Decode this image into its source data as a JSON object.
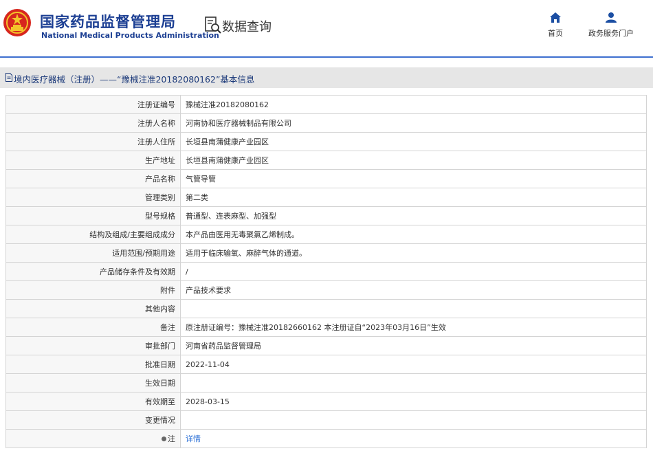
{
  "header": {
    "logo_cn": "国家药品监督管理局",
    "logo_en": "National Medical Products Administration",
    "query_title": "数据查询",
    "nav": [
      {
        "label": "首页",
        "icon": "home-icon"
      },
      {
        "label": "政务服务门户",
        "icon": "user-icon"
      }
    ]
  },
  "breadcrumb": {
    "text": "境内医疗器械（注册）——“豫械注准20182080162”基本信息",
    "icon": "document-icon"
  },
  "rows": [
    {
      "label": "注册证编号",
      "value": "豫械注准20182080162"
    },
    {
      "label": "注册人名称",
      "value": "河南协和医疗器械制品有限公司"
    },
    {
      "label": "注册人住所",
      "value": "长垣县南蒲健康产业园区"
    },
    {
      "label": "生产地址",
      "value": "长垣县南蒲健康产业园区"
    },
    {
      "label": "产品名称",
      "value": "气管导管"
    },
    {
      "label": "管理类别",
      "value": "第二类"
    },
    {
      "label": "型号规格",
      "value": "普通型、连表麻型、加强型"
    },
    {
      "label": "结构及组成/主要组成成分",
      "value": "本产品由医用无毒聚氯乙烯制成。"
    },
    {
      "label": "适用范围/预期用途",
      "value": "适用于临床输氧、麻醉气体的通道。"
    },
    {
      "label": "产品储存条件及有效期",
      "value": "/"
    },
    {
      "label": "附件",
      "value": "产品技术要求"
    },
    {
      "label": "其他内容",
      "value": ""
    },
    {
      "label": "备注",
      "value": "原注册证编号：豫械注准20182660162 本注册证自“2023年03月16日”生效"
    },
    {
      "label": "审批部门",
      "value": "河南省药品监督管理局"
    },
    {
      "label": "批准日期",
      "value": "2022-11-04"
    },
    {
      "label": "生效日期",
      "value": ""
    },
    {
      "label": "有效期至",
      "value": "2028-03-15"
    },
    {
      "label": "变更情况",
      "value": ""
    }
  ],
  "note_row": {
    "label": "注",
    "link": "详情",
    "icon": "pin-icon"
  },
  "colors": {
    "brand": "#1c3f93",
    "accent_line": "#3d6fcf",
    "link": "#2a6fd6",
    "label_bg": "#f7f7f7"
  }
}
